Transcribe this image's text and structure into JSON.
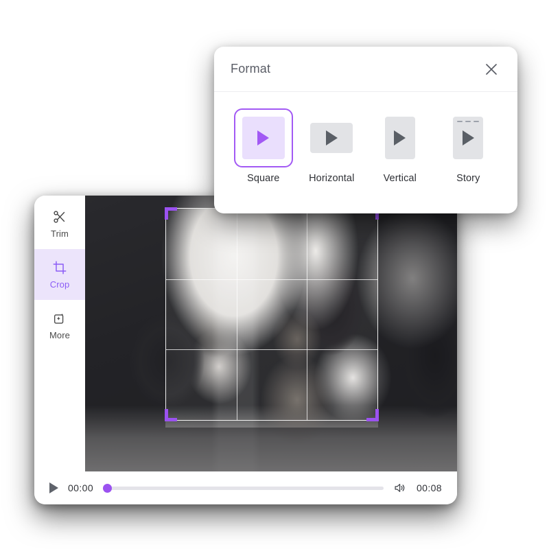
{
  "format_panel": {
    "title": "Format",
    "close_icon": "close-icon",
    "options": [
      {
        "label": "Square",
        "icon": "square-format-icon",
        "selected": true
      },
      {
        "label": "Horizontal",
        "icon": "horizontal-format-icon",
        "selected": false
      },
      {
        "label": "Vertical",
        "icon": "vertical-format-icon",
        "selected": false
      },
      {
        "label": "Story",
        "icon": "story-format-icon",
        "selected": false
      }
    ]
  },
  "editor": {
    "tools": [
      {
        "label": "Trim",
        "icon": "scissors-icon",
        "active": false
      },
      {
        "label": "Crop",
        "icon": "crop-icon",
        "active": true
      },
      {
        "label": "More",
        "icon": "sparkle-icon",
        "active": false
      }
    ],
    "player": {
      "play_icon": "play-icon",
      "current_time": "00:00",
      "total_time": "00:08",
      "volume_icon": "volume-icon",
      "progress_percent": 0
    },
    "crop_overlay": {
      "handles": [
        "top-left",
        "top-right",
        "bottom-left",
        "bottom-right"
      ],
      "grid": "rule-of-thirds"
    }
  },
  "colors": {
    "accent_purple": "#9b52f0",
    "accent_purple_light": "#eadffd",
    "tile_gray": "#e2e3e6",
    "stage_dark": "#2c2c30"
  }
}
